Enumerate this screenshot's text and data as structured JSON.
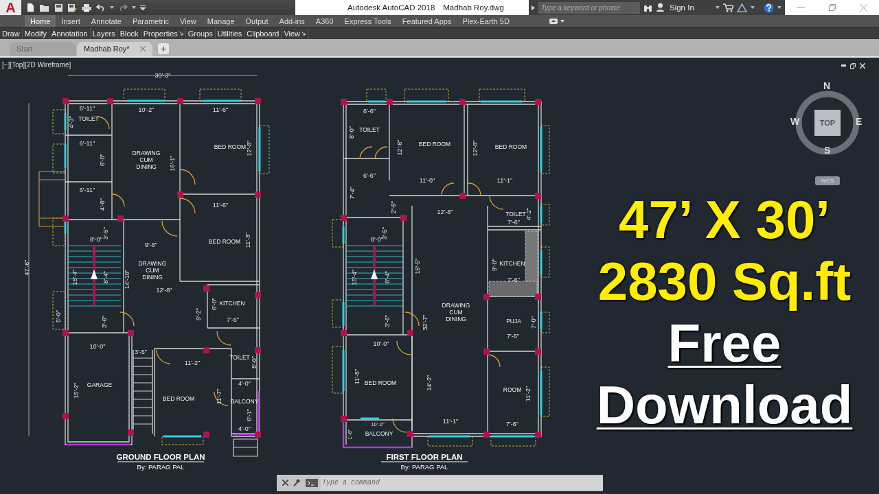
{
  "app_menu": {
    "letter": "A"
  },
  "title_bar": {
    "app_title": "Autodesk AutoCAD 2018",
    "file_name": "Madhab Roy.dwg"
  },
  "search": {
    "placeholder": "Type a keyword or phrase"
  },
  "sign_in": "Sign In",
  "ribbon_tabs": [
    {
      "label": "Home",
      "selected": true
    },
    {
      "label": "Insert",
      "selected": false
    },
    {
      "label": "Annotate",
      "selected": false
    },
    {
      "label": "Parametric",
      "selected": false
    },
    {
      "label": "View",
      "selected": false
    },
    {
      "label": "Manage",
      "selected": false
    },
    {
      "label": "Output",
      "selected": false
    },
    {
      "label": "Add-ins",
      "selected": false
    },
    {
      "label": "A360",
      "selected": false
    },
    {
      "label": "Express Tools",
      "selected": false
    },
    {
      "label": "Featured Apps",
      "selected": false
    },
    {
      "label": "Plex-Earth 5D",
      "selected": false
    }
  ],
  "ribbon_panels": [
    {
      "label": "Draw",
      "expandable": false
    },
    {
      "label": "Modify",
      "expandable": false
    },
    {
      "label": "Annotation",
      "expandable": false
    },
    {
      "label": "Layers",
      "expandable": false
    },
    {
      "label": "Block",
      "expandable": false
    },
    {
      "label": "Properties",
      "expandable": true
    },
    {
      "label": "Groups",
      "expandable": false
    },
    {
      "label": "Utilities",
      "expandable": false
    },
    {
      "label": "Clipboard",
      "expandable": false
    },
    {
      "label": "View",
      "expandable": true
    }
  ],
  "file_tabs": [
    {
      "label": "Start",
      "selected": false,
      "closable": false
    },
    {
      "label": "Madhab Roy*",
      "selected": true,
      "closable": true
    }
  ],
  "new_tab": "+",
  "viewport_label": "[−][Top][2D Wireframe]",
  "view_cube": {
    "north": "N",
    "west": "W",
    "east": "E",
    "south": "S",
    "face": "TOP",
    "ucs": "WCS"
  },
  "plans": [
    {
      "title": "GROUND FLOOR PLAN",
      "author": "By: PARAG PAL",
      "labels": [
        {
          "text": "30'-3\"",
          "kind": "dim"
        },
        {
          "text": "47'-6\"",
          "kind": "dim"
        },
        {
          "text": "6'-11\"",
          "kind": "dim"
        },
        {
          "text": "10'-2\"",
          "kind": "dim"
        },
        {
          "text": "11'-6\"",
          "kind": "dim"
        },
        {
          "text": "4'-3\"",
          "kind": "dim"
        },
        {
          "text": "TOILET",
          "kind": "room"
        },
        {
          "text": "6'-11\"",
          "kind": "dim"
        },
        {
          "text": "6'-0\"",
          "kind": "dim"
        },
        {
          "lines": [
            "DRAWING",
            "CUM",
            "DINING"
          ],
          "kind": "room"
        },
        {
          "text": "16'-1\"",
          "kind": "dim"
        },
        {
          "text": "BED ROOM",
          "kind": "room"
        },
        {
          "text": "12'-8\"",
          "kind": "dim"
        },
        {
          "text": "6'-11\"",
          "kind": "dim"
        },
        {
          "text": "4'-8\"",
          "kind": "dim"
        },
        {
          "text": "11'-6\"",
          "kind": "dim"
        },
        {
          "text": "8'-0\"",
          "kind": "dim"
        },
        {
          "text": "3'-5\"",
          "kind": "dim"
        },
        {
          "text": "9'-8\"",
          "kind": "dim"
        },
        {
          "text": "BED ROOM",
          "kind": "room"
        },
        {
          "text": "11'-3\"",
          "kind": "dim"
        },
        {
          "lines": [
            "DRAWING",
            "CUM",
            "DINING"
          ],
          "kind": "room"
        },
        {
          "text": "15'-4\"",
          "kind": "dim"
        },
        {
          "text": "8'-4\"",
          "kind": "dim"
        },
        {
          "text": "14'-10\"",
          "kind": "dim"
        },
        {
          "text": "12'-8\"",
          "kind": "dim"
        },
        {
          "text": "6'-0\"",
          "kind": "dim"
        },
        {
          "text": "KITCHEN",
          "kind": "room"
        },
        {
          "text": "9'-2\"",
          "kind": "dim"
        },
        {
          "text": "7'-6\"",
          "kind": "dim"
        },
        {
          "text": "5'-0\"",
          "kind": "dim"
        },
        {
          "text": "3'-6\"",
          "kind": "dim"
        },
        {
          "text": "10'-0\"",
          "kind": "dim"
        },
        {
          "text": "3'-5\"",
          "kind": "dim"
        },
        {
          "text": "11'-2\"",
          "kind": "dim"
        },
        {
          "text": "TOILET",
          "kind": "room"
        },
        {
          "text": "8'-0\"",
          "kind": "dim"
        },
        {
          "text": "GARAGE",
          "kind": "room"
        },
        {
          "text": "15'-2\"",
          "kind": "dim"
        },
        {
          "text": "4'-0\"",
          "kind": "dim"
        },
        {
          "text": "BED ROOM",
          "kind": "room"
        },
        {
          "text": "11'-7\"",
          "kind": "dim"
        },
        {
          "text": "BALCONY",
          "kind": "room"
        },
        {
          "text": "6'-1\"",
          "kind": "dim"
        },
        {
          "text": "4'-0\"",
          "kind": "dim"
        }
      ]
    },
    {
      "title": "FIRST FLOOR PLAN",
      "author": "By: PARAG PAL",
      "labels": [
        {
          "text": "6'-6\"",
          "kind": "dim"
        },
        {
          "text": "8'-0\"",
          "kind": "dim"
        },
        {
          "text": "TOILET",
          "kind": "room"
        },
        {
          "text": "BED ROOM",
          "kind": "room"
        },
        {
          "text": "12'-8\"",
          "kind": "dim"
        },
        {
          "text": "12'-8\"",
          "kind": "dim"
        },
        {
          "text": "BED ROOM",
          "kind": "room"
        },
        {
          "text": "6'-6\"",
          "kind": "dim"
        },
        {
          "text": "7'-4\"",
          "kind": "dim"
        },
        {
          "text": "11'-0\"",
          "kind": "dim"
        },
        {
          "text": "11'-1\"",
          "kind": "dim"
        },
        {
          "text": "2'-8\"",
          "kind": "dim"
        },
        {
          "text": "12'-8\"",
          "kind": "dim"
        },
        {
          "text": "TOILET",
          "kind": "room"
        },
        {
          "text": "4'-2\"",
          "kind": "dim"
        },
        {
          "text": "7'-6\"",
          "kind": "dim"
        },
        {
          "text": "8'-0\"",
          "kind": "dim"
        },
        {
          "text": "3'-5\"",
          "kind": "dim"
        },
        {
          "text": "18'-5\"",
          "kind": "dim"
        },
        {
          "text": "9'-0\"",
          "kind": "dim"
        },
        {
          "text": "KITCHEN",
          "kind": "room"
        },
        {
          "text": "7'-6\"",
          "kind": "dim"
        },
        {
          "text": "15'-4\"",
          "kind": "dim"
        },
        {
          "text": "8'-4\"",
          "kind": "dim"
        },
        {
          "lines": [
            "DRAWING",
            "CUM",
            "DINING"
          ],
          "kind": "room"
        },
        {
          "text": "32'-7\"",
          "kind": "dim"
        },
        {
          "text": "3'-6\"",
          "kind": "dim"
        },
        {
          "text": "PUJA",
          "kind": "room"
        },
        {
          "text": "7'-0\"",
          "kind": "dim"
        },
        {
          "text": "7'-6\"",
          "kind": "dim"
        },
        {
          "text": "10'-0\"",
          "kind": "dim"
        },
        {
          "text": "11'-5\"",
          "kind": "dim"
        },
        {
          "text": "BED ROOM",
          "kind": "room"
        },
        {
          "text": "14'-2\"",
          "kind": "dim"
        },
        {
          "text": "ROOM",
          "kind": "room"
        },
        {
          "text": "11'-2\"",
          "kind": "dim"
        },
        {
          "text": "10'-0\"",
          "kind": "small-dim"
        },
        {
          "text": "11'-1\"",
          "kind": "dim"
        },
        {
          "text": "7'-6\"",
          "kind": "dim"
        },
        {
          "text": "1'-6\"",
          "kind": "small-dim"
        },
        {
          "text": "BALCONY",
          "kind": "room"
        }
      ]
    }
  ],
  "overlay": [
    {
      "text": "47’ X 30’",
      "kind": "highlight"
    },
    {
      "text": "2830 Sq.ft",
      "kind": "highlight"
    },
    {
      "text": "Free",
      "kind": "underlined"
    },
    {
      "text": "Download",
      "kind": "underlined"
    }
  ],
  "command_line": {
    "placeholder": "Type a command"
  }
}
